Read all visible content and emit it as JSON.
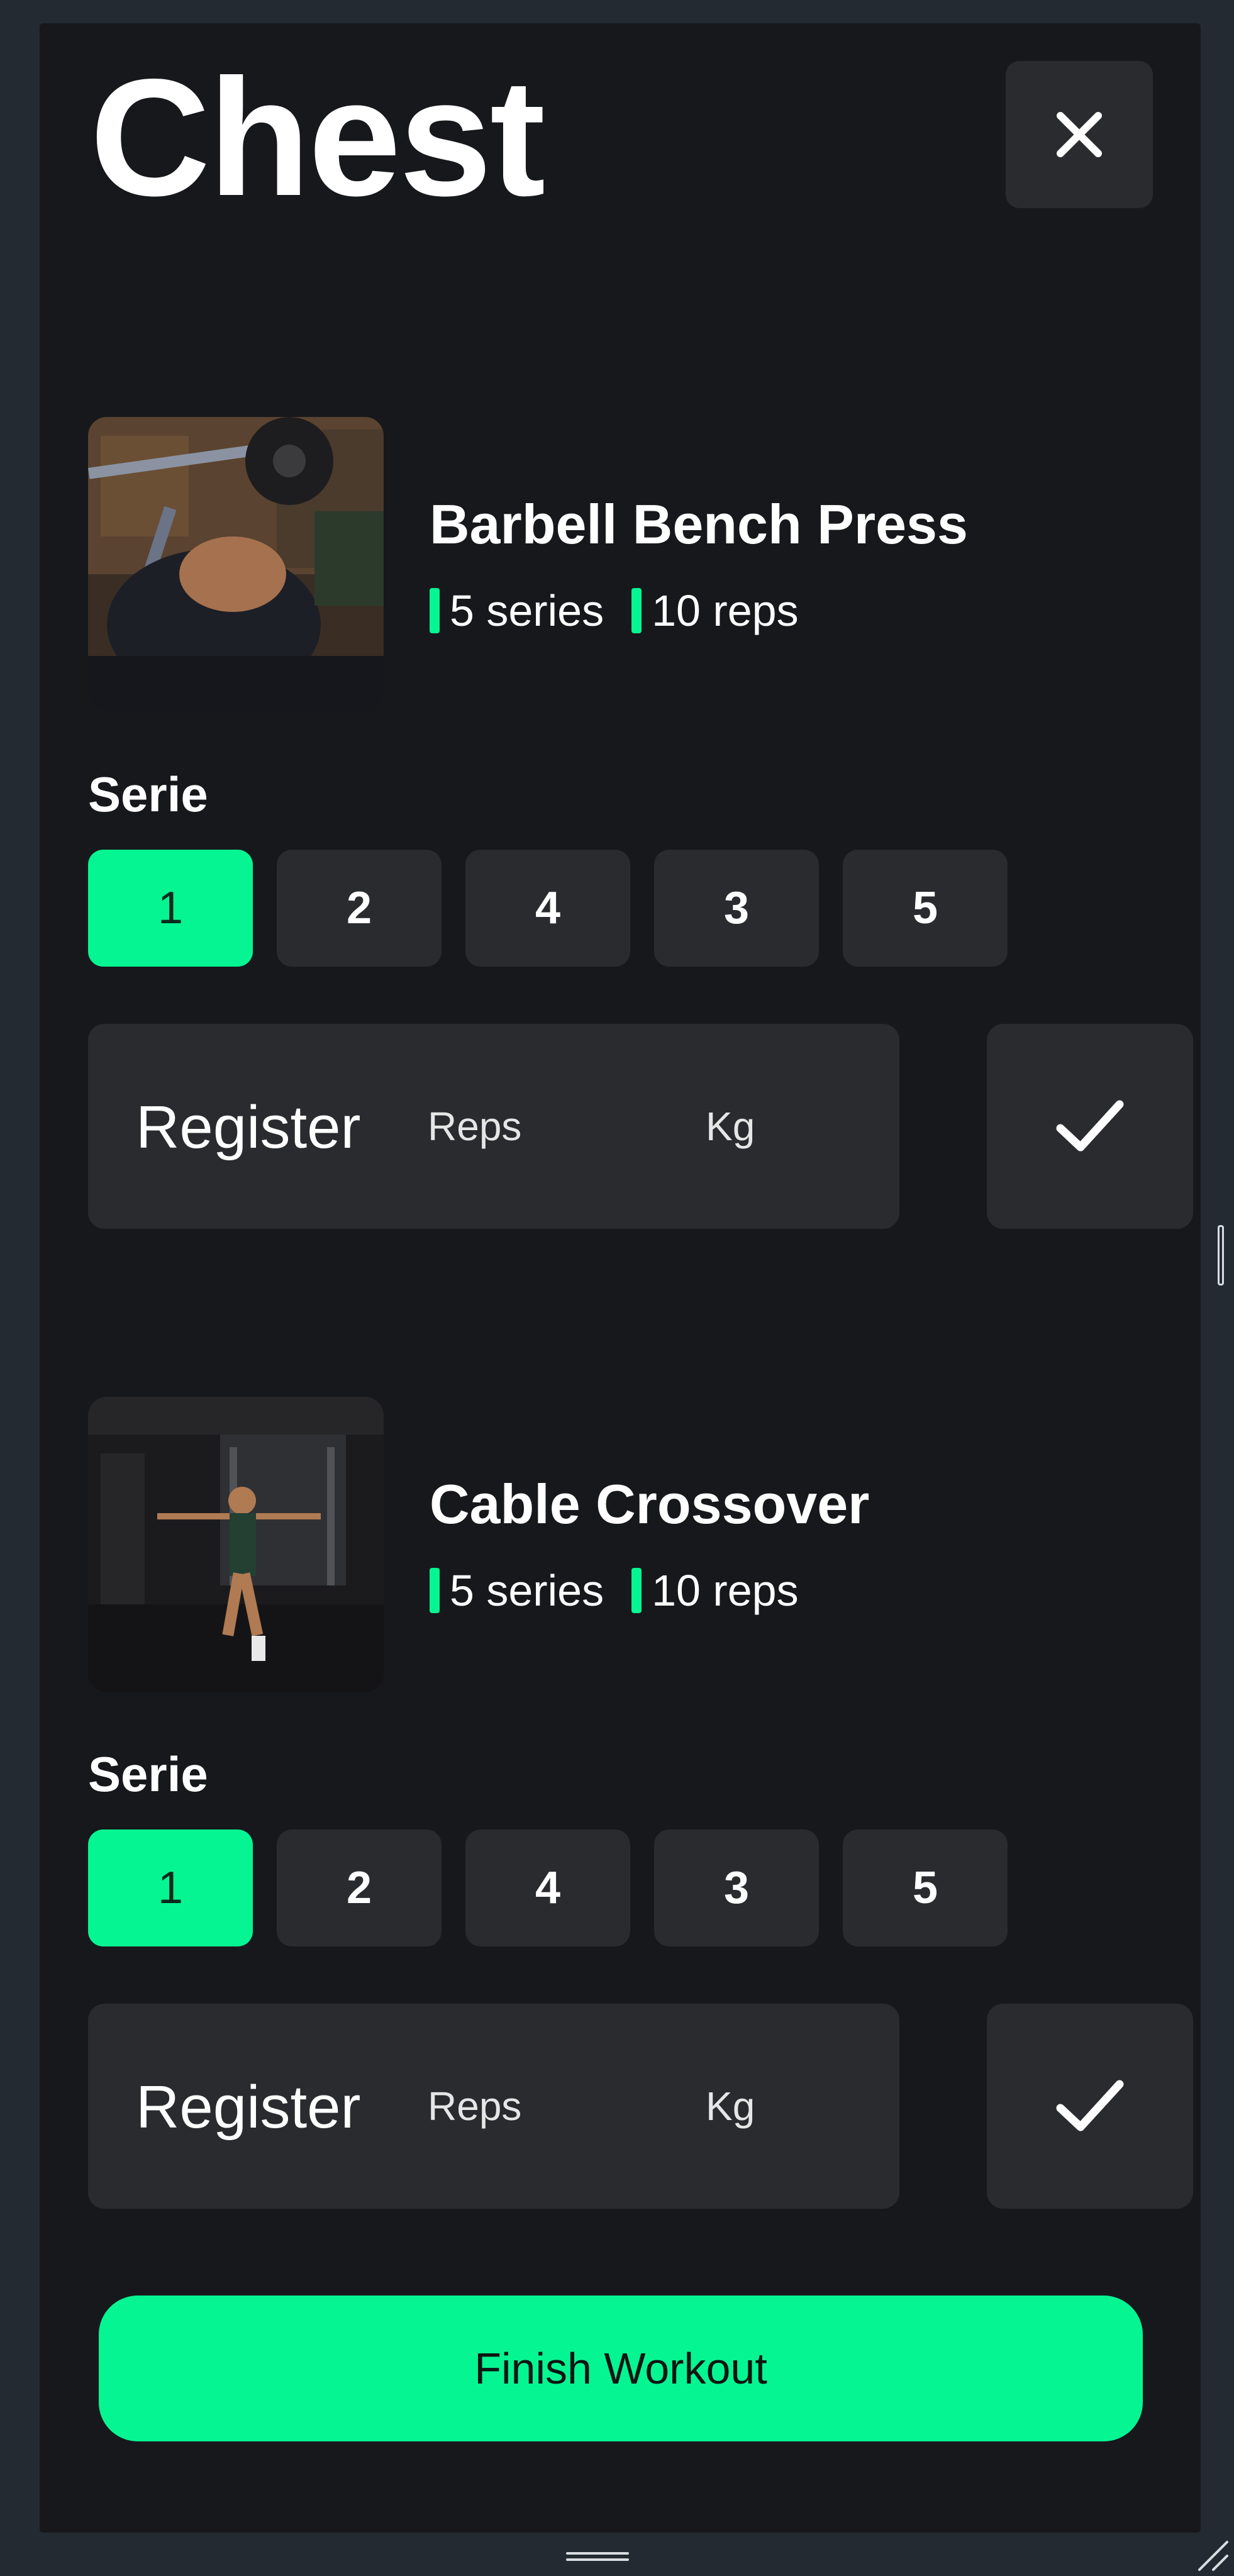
{
  "page": {
    "title": "Chest",
    "close_icon": "close-icon"
  },
  "exercises": [
    {
      "name": "Barbell Bench Press",
      "series": "5 series",
      "reps": "10 reps",
      "serie_label": "Serie",
      "serie_buttons": [
        "1",
        "2",
        "4",
        "3",
        "5"
      ],
      "active_serie": "1",
      "register_label": "Register",
      "reps_placeholder": "Reps",
      "kg_placeholder": "Kg",
      "confirm_icon": "checkmark-icon"
    },
    {
      "name": "Cable Crossover",
      "series": "5 series",
      "reps": "10 reps",
      "serie_label": "Serie",
      "serie_buttons": [
        "1",
        "2",
        "4",
        "3",
        "5"
      ],
      "active_serie": "1",
      "register_label": "Register",
      "reps_placeholder": "Reps",
      "kg_placeholder": "Kg",
      "confirm_icon": "checkmark-icon"
    }
  ],
  "finish_button": "Finish Workout",
  "colors": {
    "accent": "#05f592",
    "background": "#17181b",
    "surface": "#2a2b2f",
    "frame": "#232a31"
  }
}
